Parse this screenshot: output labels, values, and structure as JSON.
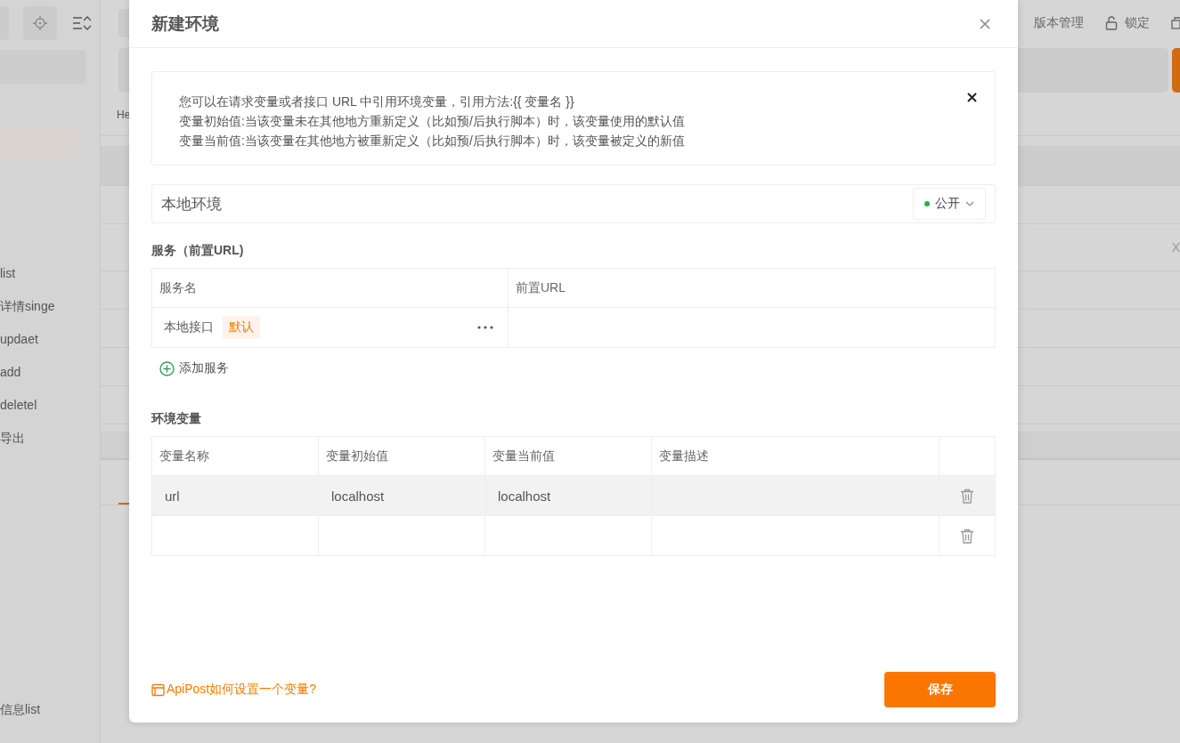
{
  "sidebar": {
    "items": [
      {
        "label": "list"
      },
      {
        "label": "详情singe"
      },
      {
        "label": "updaet"
      },
      {
        "label": "add"
      },
      {
        "label": "deletel"
      },
      {
        "label": "导出"
      }
    ],
    "bottom_items": [
      {
        "label": "信息list"
      }
    ]
  },
  "topbar": {
    "actions": [
      {
        "kind": "text",
        "label": "版本管理"
      },
      {
        "kind": "lock",
        "label": "锁定"
      },
      {
        "kind": "copy"
      }
    ]
  },
  "main": {
    "tab_label": "He",
    "cell_text": "X"
  },
  "dialog": {
    "title": "新建环境",
    "notice": [
      "您可以在请求变量或者接口 URL 中引用环境变量，引用方法:{{ 变量名 }}",
      "变量初始值:当该变量未在其他地方重新定义（比如预/后执行脚本）时，该变量使用的默认值",
      "变量当前值:当该变量在其他地方被重新定义（比如预/后执行脚本）时，该变量被定义的新值"
    ],
    "env_name": "本地环境",
    "visibility": "公开",
    "services": {
      "title": "服务（前置URL)",
      "columns": [
        "服务名",
        "前置URL"
      ],
      "rows": [
        {
          "name": "本地接口",
          "badge": "默认"
        }
      ],
      "add_label": "添加服务"
    },
    "variables": {
      "title": "环境变量",
      "columns": [
        "变量名称",
        "变量初始值",
        "变量当前值",
        "变量描述"
      ],
      "rows": [
        {
          "active": true,
          "name": "url",
          "initial_value": "localhost",
          "current_value": "localhost"
        },
        {
          "active": false
        }
      ]
    },
    "help_link": "ApiPost如何设置一个变量?",
    "save_label": "保存"
  }
}
